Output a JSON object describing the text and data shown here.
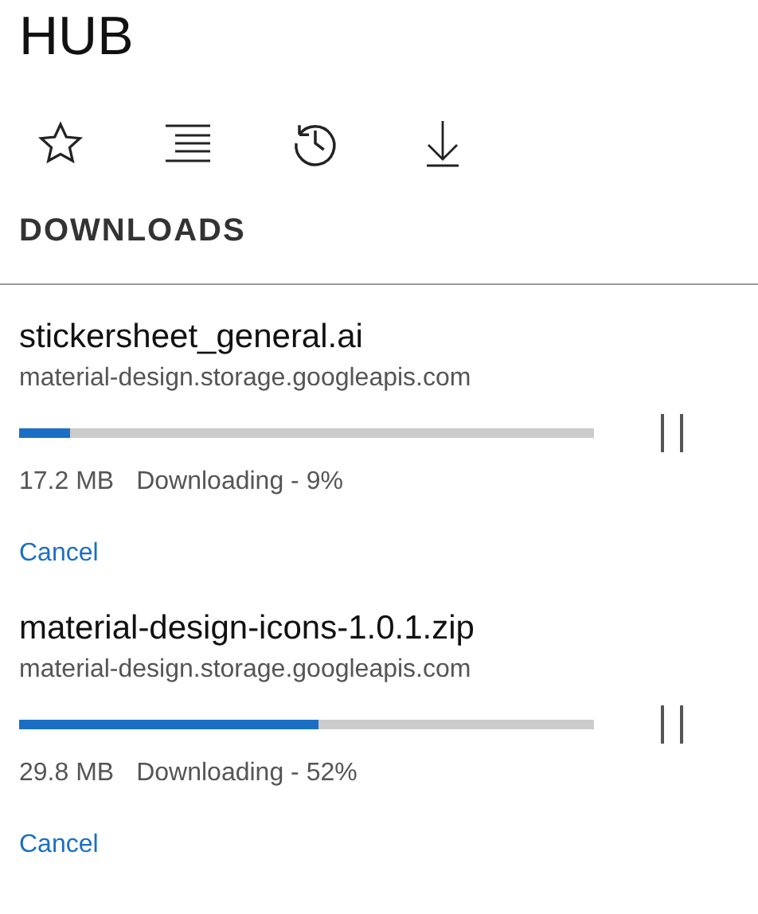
{
  "title": "HUB",
  "section": "DOWNLOADS",
  "downloads": [
    {
      "name": "stickersheet_general.ai",
      "source": "material-design.storage.googleapis.com",
      "level": 0.09,
      "size": "17.2 MB",
      "status": "Downloading - 9%",
      "action": "Cancel"
    },
    {
      "name": "material-design-icons-1.0.1.zip",
      "source": "material-design.storage.googleapis.com",
      "level": 0.52,
      "size": "29.8 MB",
      "status": "Downloading - 52%",
      "action": "Cancel"
    }
  ]
}
